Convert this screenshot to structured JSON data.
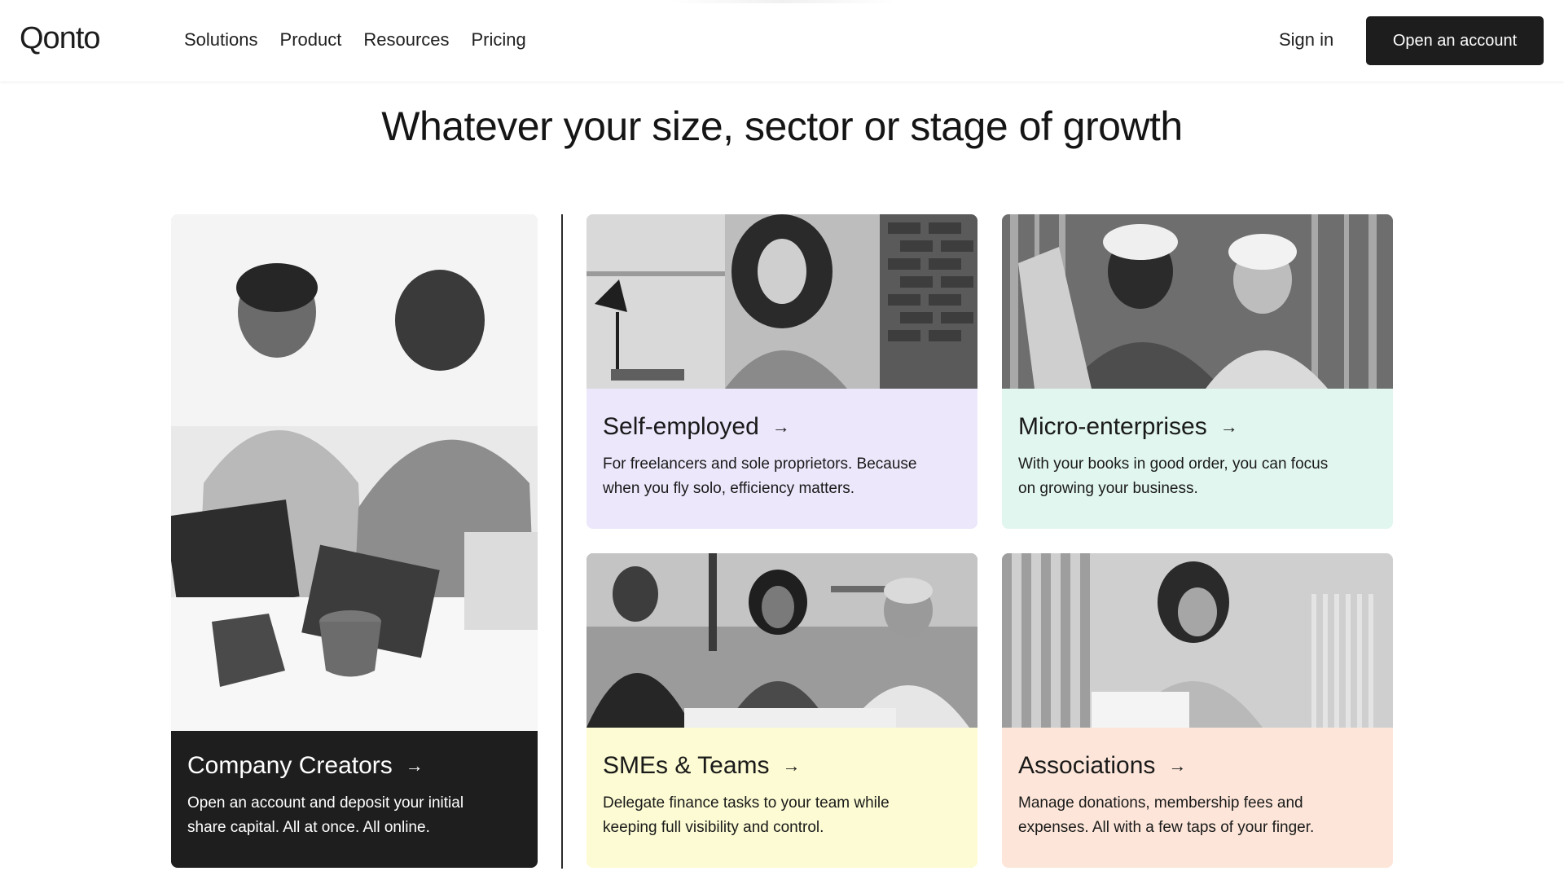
{
  "header": {
    "logo": "Qonto",
    "nav": [
      "Solutions",
      "Product",
      "Resources",
      "Pricing"
    ],
    "sign_in": "Sign in",
    "cta": "Open an account"
  },
  "main": {
    "title": "Whatever your size, sector or stage of growth",
    "cards": [
      {
        "title": "Company Creators",
        "description_line1": "Open an account and deposit your initial",
        "description_line2": "share capital. All at once. All online.",
        "color": "#1e1e1e",
        "arrow_icon": "arrow-right-icon"
      },
      {
        "title": "Self-employed",
        "description_line1": "For freelancers and sole proprietors. Because",
        "description_line2": "when you fly solo, efficiency matters.",
        "color": "#ece7fb",
        "arrow_icon": "arrow-right-icon"
      },
      {
        "title": "Micro-enterprises",
        "description_line1": "With your books in good order, you can focus",
        "description_line2": "on growing your business.",
        "color": "#e1f6ee",
        "arrow_icon": "arrow-right-icon"
      },
      {
        "title": "SMEs & Teams",
        "description_line1": "Delegate finance tasks to your team while",
        "description_line2": "keeping full visibility and control.",
        "color": "#fcfbd3",
        "arrow_icon": "arrow-right-icon"
      },
      {
        "title": "Associations",
        "description_line1": "Manage donations, membership fees and",
        "description_line2": "expenses. All with a few taps of your finger.",
        "color": "#fde6d9",
        "arrow_icon": "arrow-right-icon"
      }
    ]
  }
}
